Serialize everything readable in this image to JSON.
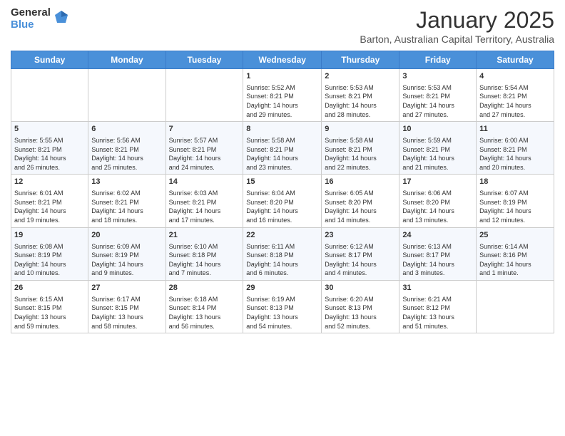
{
  "header": {
    "logo_general": "General",
    "logo_blue": "Blue",
    "title": "January 2025",
    "subtitle": "Barton, Australian Capital Territory, Australia"
  },
  "days_of_week": [
    "Sunday",
    "Monday",
    "Tuesday",
    "Wednesday",
    "Thursday",
    "Friday",
    "Saturday"
  ],
  "weeks": [
    [
      {
        "num": "",
        "info": ""
      },
      {
        "num": "",
        "info": ""
      },
      {
        "num": "",
        "info": ""
      },
      {
        "num": "1",
        "info": "Sunrise: 5:52 AM\nSunset: 8:21 PM\nDaylight: 14 hours\nand 29 minutes."
      },
      {
        "num": "2",
        "info": "Sunrise: 5:53 AM\nSunset: 8:21 PM\nDaylight: 14 hours\nand 28 minutes."
      },
      {
        "num": "3",
        "info": "Sunrise: 5:53 AM\nSunset: 8:21 PM\nDaylight: 14 hours\nand 27 minutes."
      },
      {
        "num": "4",
        "info": "Sunrise: 5:54 AM\nSunset: 8:21 PM\nDaylight: 14 hours\nand 27 minutes."
      }
    ],
    [
      {
        "num": "5",
        "info": "Sunrise: 5:55 AM\nSunset: 8:21 PM\nDaylight: 14 hours\nand 26 minutes."
      },
      {
        "num": "6",
        "info": "Sunrise: 5:56 AM\nSunset: 8:21 PM\nDaylight: 14 hours\nand 25 minutes."
      },
      {
        "num": "7",
        "info": "Sunrise: 5:57 AM\nSunset: 8:21 PM\nDaylight: 14 hours\nand 24 minutes."
      },
      {
        "num": "8",
        "info": "Sunrise: 5:58 AM\nSunset: 8:21 PM\nDaylight: 14 hours\nand 23 minutes."
      },
      {
        "num": "9",
        "info": "Sunrise: 5:58 AM\nSunset: 8:21 PM\nDaylight: 14 hours\nand 22 minutes."
      },
      {
        "num": "10",
        "info": "Sunrise: 5:59 AM\nSunset: 8:21 PM\nDaylight: 14 hours\nand 21 minutes."
      },
      {
        "num": "11",
        "info": "Sunrise: 6:00 AM\nSunset: 8:21 PM\nDaylight: 14 hours\nand 20 minutes."
      }
    ],
    [
      {
        "num": "12",
        "info": "Sunrise: 6:01 AM\nSunset: 8:21 PM\nDaylight: 14 hours\nand 19 minutes."
      },
      {
        "num": "13",
        "info": "Sunrise: 6:02 AM\nSunset: 8:21 PM\nDaylight: 14 hours\nand 18 minutes."
      },
      {
        "num": "14",
        "info": "Sunrise: 6:03 AM\nSunset: 8:21 PM\nDaylight: 14 hours\nand 17 minutes."
      },
      {
        "num": "15",
        "info": "Sunrise: 6:04 AM\nSunset: 8:20 PM\nDaylight: 14 hours\nand 16 minutes."
      },
      {
        "num": "16",
        "info": "Sunrise: 6:05 AM\nSunset: 8:20 PM\nDaylight: 14 hours\nand 14 minutes."
      },
      {
        "num": "17",
        "info": "Sunrise: 6:06 AM\nSunset: 8:20 PM\nDaylight: 14 hours\nand 13 minutes."
      },
      {
        "num": "18",
        "info": "Sunrise: 6:07 AM\nSunset: 8:19 PM\nDaylight: 14 hours\nand 12 minutes."
      }
    ],
    [
      {
        "num": "19",
        "info": "Sunrise: 6:08 AM\nSunset: 8:19 PM\nDaylight: 14 hours\nand 10 minutes."
      },
      {
        "num": "20",
        "info": "Sunrise: 6:09 AM\nSunset: 8:19 PM\nDaylight: 14 hours\nand 9 minutes."
      },
      {
        "num": "21",
        "info": "Sunrise: 6:10 AM\nSunset: 8:18 PM\nDaylight: 14 hours\nand 7 minutes."
      },
      {
        "num": "22",
        "info": "Sunrise: 6:11 AM\nSunset: 8:18 PM\nDaylight: 14 hours\nand 6 minutes."
      },
      {
        "num": "23",
        "info": "Sunrise: 6:12 AM\nSunset: 8:17 PM\nDaylight: 14 hours\nand 4 minutes."
      },
      {
        "num": "24",
        "info": "Sunrise: 6:13 AM\nSunset: 8:17 PM\nDaylight: 14 hours\nand 3 minutes."
      },
      {
        "num": "25",
        "info": "Sunrise: 6:14 AM\nSunset: 8:16 PM\nDaylight: 14 hours\nand 1 minute."
      }
    ],
    [
      {
        "num": "26",
        "info": "Sunrise: 6:15 AM\nSunset: 8:15 PM\nDaylight: 13 hours\nand 59 minutes."
      },
      {
        "num": "27",
        "info": "Sunrise: 6:17 AM\nSunset: 8:15 PM\nDaylight: 13 hours\nand 58 minutes."
      },
      {
        "num": "28",
        "info": "Sunrise: 6:18 AM\nSunset: 8:14 PM\nDaylight: 13 hours\nand 56 minutes."
      },
      {
        "num": "29",
        "info": "Sunrise: 6:19 AM\nSunset: 8:13 PM\nDaylight: 13 hours\nand 54 minutes."
      },
      {
        "num": "30",
        "info": "Sunrise: 6:20 AM\nSunset: 8:13 PM\nDaylight: 13 hours\nand 52 minutes."
      },
      {
        "num": "31",
        "info": "Sunrise: 6:21 AM\nSunset: 8:12 PM\nDaylight: 13 hours\nand 51 minutes."
      },
      {
        "num": "",
        "info": ""
      }
    ]
  ]
}
